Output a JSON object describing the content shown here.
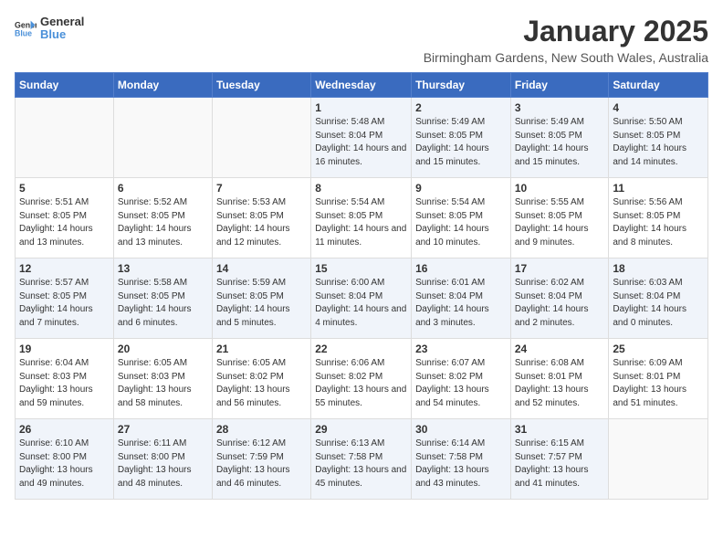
{
  "logo": {
    "general": "General",
    "blue": "Blue"
  },
  "title": "January 2025",
  "location": "Birmingham Gardens, New South Wales, Australia",
  "weekdays": [
    "Sunday",
    "Monday",
    "Tuesday",
    "Wednesday",
    "Thursday",
    "Friday",
    "Saturday"
  ],
  "weeks": [
    [
      {
        "day": "",
        "info": ""
      },
      {
        "day": "",
        "info": ""
      },
      {
        "day": "",
        "info": ""
      },
      {
        "day": "1",
        "info": "Sunrise: 5:48 AM\nSunset: 8:04 PM\nDaylight: 14 hours\nand 16 minutes."
      },
      {
        "day": "2",
        "info": "Sunrise: 5:49 AM\nSunset: 8:05 PM\nDaylight: 14 hours\nand 15 minutes."
      },
      {
        "day": "3",
        "info": "Sunrise: 5:49 AM\nSunset: 8:05 PM\nDaylight: 14 hours\nand 15 minutes."
      },
      {
        "day": "4",
        "info": "Sunrise: 5:50 AM\nSunset: 8:05 PM\nDaylight: 14 hours\nand 14 minutes."
      }
    ],
    [
      {
        "day": "5",
        "info": "Sunrise: 5:51 AM\nSunset: 8:05 PM\nDaylight: 14 hours\nand 13 minutes."
      },
      {
        "day": "6",
        "info": "Sunrise: 5:52 AM\nSunset: 8:05 PM\nDaylight: 14 hours\nand 13 minutes."
      },
      {
        "day": "7",
        "info": "Sunrise: 5:53 AM\nSunset: 8:05 PM\nDaylight: 14 hours\nand 12 minutes."
      },
      {
        "day": "8",
        "info": "Sunrise: 5:54 AM\nSunset: 8:05 PM\nDaylight: 14 hours\nand 11 minutes."
      },
      {
        "day": "9",
        "info": "Sunrise: 5:54 AM\nSunset: 8:05 PM\nDaylight: 14 hours\nand 10 minutes."
      },
      {
        "day": "10",
        "info": "Sunrise: 5:55 AM\nSunset: 8:05 PM\nDaylight: 14 hours\nand 9 minutes."
      },
      {
        "day": "11",
        "info": "Sunrise: 5:56 AM\nSunset: 8:05 PM\nDaylight: 14 hours\nand 8 minutes."
      }
    ],
    [
      {
        "day": "12",
        "info": "Sunrise: 5:57 AM\nSunset: 8:05 PM\nDaylight: 14 hours\nand 7 minutes."
      },
      {
        "day": "13",
        "info": "Sunrise: 5:58 AM\nSunset: 8:05 PM\nDaylight: 14 hours\nand 6 minutes."
      },
      {
        "day": "14",
        "info": "Sunrise: 5:59 AM\nSunset: 8:05 PM\nDaylight: 14 hours\nand 5 minutes."
      },
      {
        "day": "15",
        "info": "Sunrise: 6:00 AM\nSunset: 8:04 PM\nDaylight: 14 hours\nand 4 minutes."
      },
      {
        "day": "16",
        "info": "Sunrise: 6:01 AM\nSunset: 8:04 PM\nDaylight: 14 hours\nand 3 minutes."
      },
      {
        "day": "17",
        "info": "Sunrise: 6:02 AM\nSunset: 8:04 PM\nDaylight: 14 hours\nand 2 minutes."
      },
      {
        "day": "18",
        "info": "Sunrise: 6:03 AM\nSunset: 8:04 PM\nDaylight: 14 hours\nand 0 minutes."
      }
    ],
    [
      {
        "day": "19",
        "info": "Sunrise: 6:04 AM\nSunset: 8:03 PM\nDaylight: 13 hours\nand 59 minutes."
      },
      {
        "day": "20",
        "info": "Sunrise: 6:05 AM\nSunset: 8:03 PM\nDaylight: 13 hours\nand 58 minutes."
      },
      {
        "day": "21",
        "info": "Sunrise: 6:05 AM\nSunset: 8:02 PM\nDaylight: 13 hours\nand 56 minutes."
      },
      {
        "day": "22",
        "info": "Sunrise: 6:06 AM\nSunset: 8:02 PM\nDaylight: 13 hours\nand 55 minutes."
      },
      {
        "day": "23",
        "info": "Sunrise: 6:07 AM\nSunset: 8:02 PM\nDaylight: 13 hours\nand 54 minutes."
      },
      {
        "day": "24",
        "info": "Sunrise: 6:08 AM\nSunset: 8:01 PM\nDaylight: 13 hours\nand 52 minutes."
      },
      {
        "day": "25",
        "info": "Sunrise: 6:09 AM\nSunset: 8:01 PM\nDaylight: 13 hours\nand 51 minutes."
      }
    ],
    [
      {
        "day": "26",
        "info": "Sunrise: 6:10 AM\nSunset: 8:00 PM\nDaylight: 13 hours\nand 49 minutes."
      },
      {
        "day": "27",
        "info": "Sunrise: 6:11 AM\nSunset: 8:00 PM\nDaylight: 13 hours\nand 48 minutes."
      },
      {
        "day": "28",
        "info": "Sunrise: 6:12 AM\nSunset: 7:59 PM\nDaylight: 13 hours\nand 46 minutes."
      },
      {
        "day": "29",
        "info": "Sunrise: 6:13 AM\nSunset: 7:58 PM\nDaylight: 13 hours\nand 45 minutes."
      },
      {
        "day": "30",
        "info": "Sunrise: 6:14 AM\nSunset: 7:58 PM\nDaylight: 13 hours\nand 43 minutes."
      },
      {
        "day": "31",
        "info": "Sunrise: 6:15 AM\nSunset: 7:57 PM\nDaylight: 13 hours\nand 41 minutes."
      },
      {
        "day": "",
        "info": ""
      }
    ]
  ]
}
